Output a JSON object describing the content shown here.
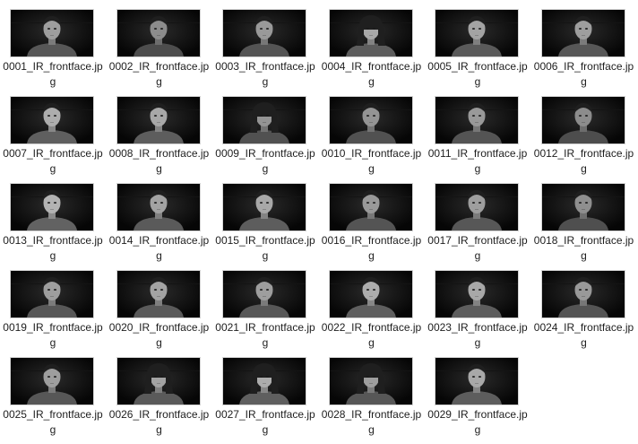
{
  "files": [
    {
      "name": "0001_IR_frontface.jpg",
      "face": {
        "hair": "short",
        "tone": 0.62
      }
    },
    {
      "name": "0002_IR_frontface.jpg",
      "face": {
        "hair": "short",
        "tone": 0.55
      }
    },
    {
      "name": "0003_IR_frontface.jpg",
      "face": {
        "hair": "short",
        "tone": 0.6
      }
    },
    {
      "name": "0004_IR_frontface.jpg",
      "face": {
        "hair": "long",
        "tone": 0.66
      }
    },
    {
      "name": "0005_IR_frontface.jpg",
      "face": {
        "hair": "short",
        "tone": 0.64
      }
    },
    {
      "name": "0006_IR_frontface.jpg",
      "face": {
        "hair": "short",
        "tone": 0.62
      }
    },
    {
      "name": "0007_IR_frontface.jpg",
      "face": {
        "hair": "short",
        "tone": 0.68
      }
    },
    {
      "name": "0008_IR_frontface.jpg",
      "face": {
        "hair": "short",
        "tone": 0.66
      }
    },
    {
      "name": "0009_IR_frontface.jpg",
      "face": {
        "hair": "long",
        "tone": 0.58
      }
    },
    {
      "name": "0010_IR_frontface.jpg",
      "face": {
        "hair": "short",
        "tone": 0.58
      }
    },
    {
      "name": "0011_IR_frontface.jpg",
      "face": {
        "hair": "short",
        "tone": 0.6
      }
    },
    {
      "name": "0012_IR_frontface.jpg",
      "face": {
        "hair": "short",
        "tone": 0.55
      }
    },
    {
      "name": "0013_IR_frontface.jpg",
      "face": {
        "hair": "short",
        "tone": 0.7
      }
    },
    {
      "name": "0014_IR_frontface.jpg",
      "face": {
        "hair": "short",
        "tone": 0.64
      }
    },
    {
      "name": "0015_IR_frontface.jpg",
      "face": {
        "hair": "short",
        "tone": 0.66
      }
    },
    {
      "name": "0016_IR_frontface.jpg",
      "face": {
        "hair": "short",
        "tone": 0.6
      }
    },
    {
      "name": "0017_IR_frontface.jpg",
      "face": {
        "hair": "short",
        "tone": 0.62
      }
    },
    {
      "name": "0018_IR_frontface.jpg",
      "face": {
        "hair": "short",
        "tone": 0.56
      }
    },
    {
      "name": "0019_IR_frontface.jpg",
      "face": {
        "hair": "short",
        "tone": 0.62
      }
    },
    {
      "name": "0020_IR_frontface.jpg",
      "face": {
        "hair": "short",
        "tone": 0.64
      }
    },
    {
      "name": "0021_IR_frontface.jpg",
      "face": {
        "hair": "short",
        "tone": 0.62
      }
    },
    {
      "name": "0022_IR_frontface.jpg",
      "face": {
        "hair": "short",
        "tone": 0.68
      }
    },
    {
      "name": "0023_IR_frontface.jpg",
      "face": {
        "hair": "short",
        "tone": 0.66
      }
    },
    {
      "name": "0024_IR_frontface.jpg",
      "face": {
        "hair": "short",
        "tone": 0.6
      }
    },
    {
      "name": "0025_IR_frontface.jpg",
      "face": {
        "hair": "short",
        "tone": 0.62
      }
    },
    {
      "name": "0026_IR_frontface.jpg",
      "face": {
        "hair": "long",
        "tone": 0.64
      }
    },
    {
      "name": "0027_IR_frontface.jpg",
      "face": {
        "hair": "long",
        "tone": 0.68
      }
    },
    {
      "name": "0028_IR_frontface.jpg",
      "face": {
        "hair": "long",
        "tone": 0.62
      }
    },
    {
      "name": "0029_IR_frontface.jpg",
      "face": {
        "hair": "short",
        "tone": 0.66
      }
    }
  ]
}
